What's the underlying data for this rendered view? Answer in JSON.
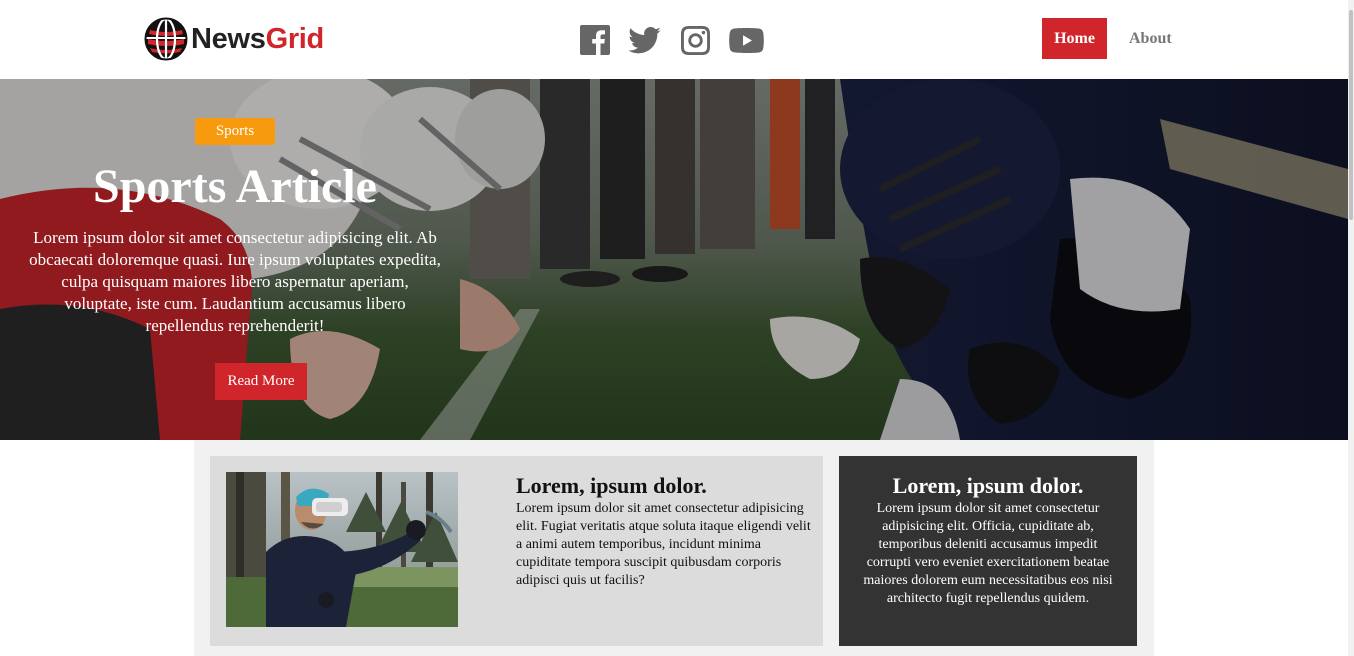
{
  "brand": {
    "name_part1": "News",
    "name_part2": "Grid",
    "accent_color": "#d0262b"
  },
  "socials": [
    {
      "icon": "facebook-icon",
      "label": "Facebook"
    },
    {
      "icon": "twitter-icon",
      "label": "Twitter"
    },
    {
      "icon": "instagram-icon",
      "label": "Instagram"
    },
    {
      "icon": "youtube-icon",
      "label": "YouTube"
    }
  ],
  "nav": {
    "home": "Home",
    "about": "About",
    "active": "Home"
  },
  "hero": {
    "tag": "Sports",
    "tag_color": "#f89a0e",
    "title": "Sports Article",
    "text": "Lorem ipsum dolor sit amet consectetur adipisicing elit. Ab obcaecati doloremque quasi. Iure ipsum voluptates expedita, culpa quisquam maiores libero aspernatur aperiam, voluptate, iste cum. Laudantium accusamus libero repellendus reprehenderit!",
    "button": "Read More"
  },
  "cards": {
    "light": {
      "title": "Lorem, ipsum dolor.",
      "text": "Lorem ipsum dolor sit amet consectetur adipisicing elit. Fugiat veritatis atque soluta itaque eligendi velit a animi autem temporibus, incidunt minima cupiditate tempora suscipit quibusdam corporis adipisci quis ut facilis?"
    },
    "dark": {
      "title": "Lorem, ipsum dolor.",
      "text": "Lorem ipsum dolor sit amet consectetur adipisicing elit. Officia, cupiditate ab, temporibus deleniti accusamus impedit corrupti vero eveniet exercitationem beatae maiores dolorem eum necessitatibus eos nisi architecto fugit repellendus quidem."
    }
  }
}
